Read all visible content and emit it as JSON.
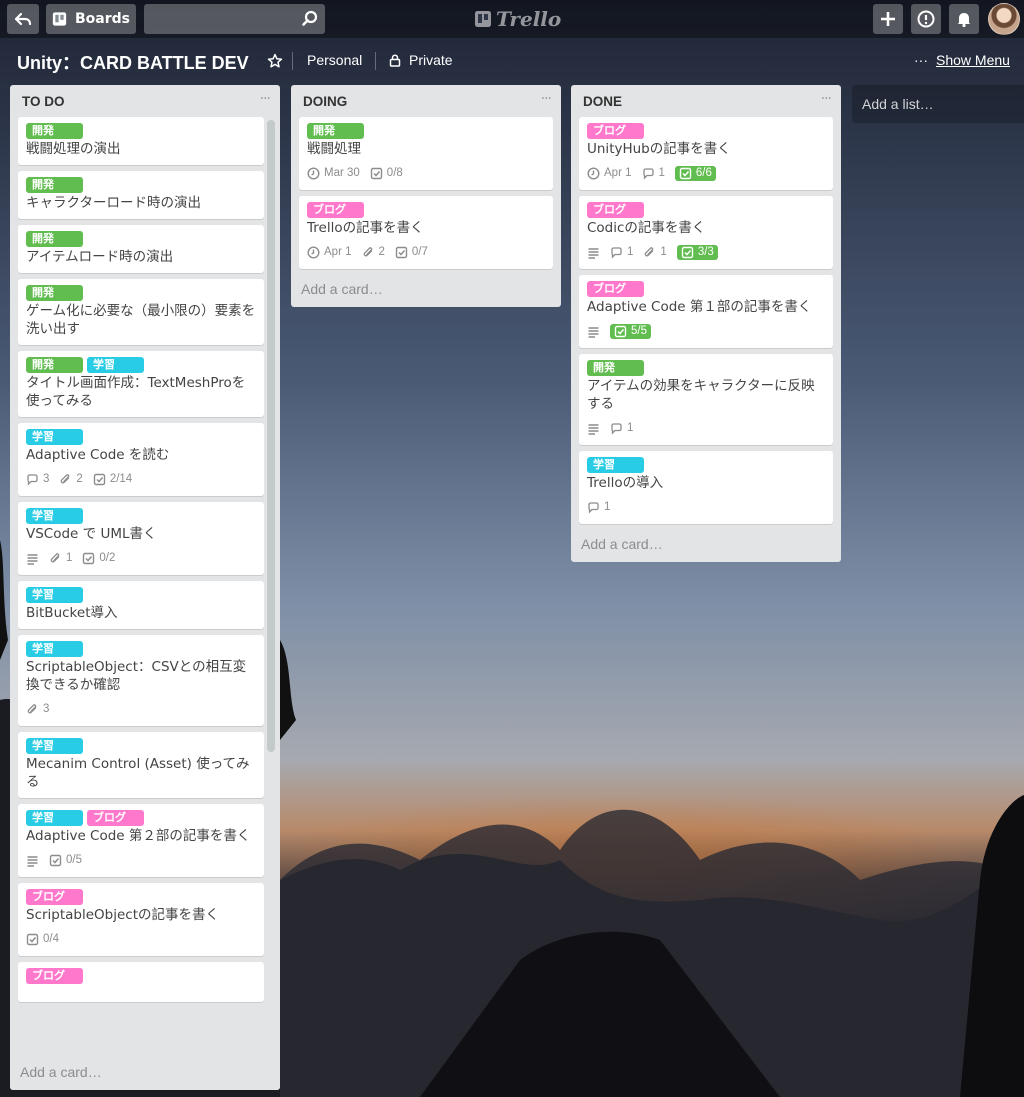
{
  "header": {
    "boards_label": "Boards",
    "search_value": "",
    "logo_text": "Trello"
  },
  "board": {
    "title": "Unity：CARD BATTLE DEV",
    "team": "Personal",
    "visibility": "Private",
    "show_menu": "Show Menu"
  },
  "colors": {
    "label_green": "#61bd4f",
    "label_pink": "#ff78cb",
    "label_sky": "#29cce5"
  },
  "lists": [
    {
      "title": "TO DO",
      "add_card": "Add a card…",
      "cards": [
        {
          "labels": [
            {
              "text": "開発",
              "color": "green"
            }
          ],
          "title": "戦闘処理の演出",
          "badges": []
        },
        {
          "labels": [
            {
              "text": "開発",
              "color": "green"
            }
          ],
          "title": "キャラクターロード時の演出",
          "badges": []
        },
        {
          "labels": [
            {
              "text": "開発",
              "color": "green"
            }
          ],
          "title": "アイテムロード時の演出",
          "badges": []
        },
        {
          "labels": [
            {
              "text": "開発",
              "color": "green"
            }
          ],
          "title": "ゲーム化に必要な（最小限の）要素を洗い出す",
          "badges": []
        },
        {
          "labels": [
            {
              "text": "開発",
              "color": "green"
            },
            {
              "text": "学習",
              "color": "sky"
            }
          ],
          "title": "タイトル画面作成：TextMeshProを使ってみる",
          "badges": []
        },
        {
          "labels": [
            {
              "text": "学習",
              "color": "sky"
            }
          ],
          "title": "Adaptive Code を読む",
          "badges": [
            {
              "icon": "comment",
              "text": "3"
            },
            {
              "icon": "attachment",
              "text": "2"
            },
            {
              "icon": "checklist",
              "text": "2/14"
            }
          ]
        },
        {
          "labels": [
            {
              "text": "学習",
              "color": "sky"
            }
          ],
          "title": "VSCode で UML書く",
          "badges": [
            {
              "icon": "description",
              "text": ""
            },
            {
              "icon": "attachment",
              "text": "1"
            },
            {
              "icon": "checklist",
              "text": "0/2"
            }
          ]
        },
        {
          "labels": [
            {
              "text": "学習",
              "color": "sky"
            }
          ],
          "title": "BitBucket導入",
          "badges": []
        },
        {
          "labels": [
            {
              "text": "学習",
              "color": "sky"
            }
          ],
          "title": "ScriptableObject：CSVとの相互変換できるか確認",
          "badges": [
            {
              "icon": "attachment",
              "text": "3"
            }
          ]
        },
        {
          "labels": [
            {
              "text": "学習",
              "color": "sky"
            }
          ],
          "title": "Mecanim Control (Asset) 使ってみる",
          "badges": []
        },
        {
          "labels": [
            {
              "text": "学習",
              "color": "sky"
            },
            {
              "text": "ブログ",
              "color": "pink"
            }
          ],
          "title": "Adaptive Code 第２部の記事を書く",
          "badges": [
            {
              "icon": "description",
              "text": ""
            },
            {
              "icon": "checklist",
              "text": "0/5"
            }
          ]
        },
        {
          "labels": [
            {
              "text": "ブログ",
              "color": "pink"
            }
          ],
          "title": "ScriptableObjectの記事を書く",
          "badges": [
            {
              "icon": "checklist",
              "text": "0/4"
            }
          ]
        },
        {
          "labels": [
            {
              "text": "ブログ",
              "color": "pink"
            }
          ],
          "title": "",
          "badges": []
        }
      ]
    },
    {
      "title": "DOING",
      "add_card": "Add a card…",
      "cards": [
        {
          "labels": [
            {
              "text": "開発",
              "color": "green"
            }
          ],
          "title": "戦闘処理",
          "badges": [
            {
              "icon": "clock",
              "text": "Mar 30"
            },
            {
              "icon": "checklist",
              "text": "0/8"
            }
          ]
        },
        {
          "labels": [
            {
              "text": "ブログ",
              "color": "pink"
            }
          ],
          "title": "Trelloの記事を書く",
          "badges": [
            {
              "icon": "clock",
              "text": "Apr 1"
            },
            {
              "icon": "attachment",
              "text": "2"
            },
            {
              "icon": "checklist",
              "text": "0/7"
            }
          ]
        }
      ]
    },
    {
      "title": "DONE",
      "add_card": "Add a card…",
      "cards": [
        {
          "labels": [
            {
              "text": "ブログ",
              "color": "pink"
            }
          ],
          "title": "UnityHubの記事を書く",
          "badges": [
            {
              "icon": "clock",
              "text": "Apr 1"
            },
            {
              "icon": "comment",
              "text": "1"
            },
            {
              "icon": "checklist",
              "text": "6/6",
              "complete": true
            }
          ]
        },
        {
          "labels": [
            {
              "text": "ブログ",
              "color": "pink"
            }
          ],
          "title": "Codicの記事を書く",
          "badges": [
            {
              "icon": "description",
              "text": ""
            },
            {
              "icon": "comment",
              "text": "1"
            },
            {
              "icon": "attachment",
              "text": "1"
            },
            {
              "icon": "checklist",
              "text": "3/3",
              "complete": true
            }
          ]
        },
        {
          "labels": [
            {
              "text": "ブログ",
              "color": "pink"
            }
          ],
          "title": "Adaptive Code 第１部の記事を書く",
          "badges": [
            {
              "icon": "description",
              "text": ""
            },
            {
              "icon": "checklist",
              "text": "5/5",
              "complete": true
            }
          ]
        },
        {
          "labels": [
            {
              "text": "開発",
              "color": "green"
            }
          ],
          "title": "アイテムの効果をキャラクターに反映する",
          "badges": [
            {
              "icon": "description",
              "text": ""
            },
            {
              "icon": "comment",
              "text": "1"
            }
          ]
        },
        {
          "labels": [
            {
              "text": "学習",
              "color": "sky"
            }
          ],
          "title": "Trelloの導入",
          "badges": [
            {
              "icon": "comment",
              "text": "1"
            }
          ]
        }
      ]
    }
  ],
  "add_list": "Add a list…"
}
